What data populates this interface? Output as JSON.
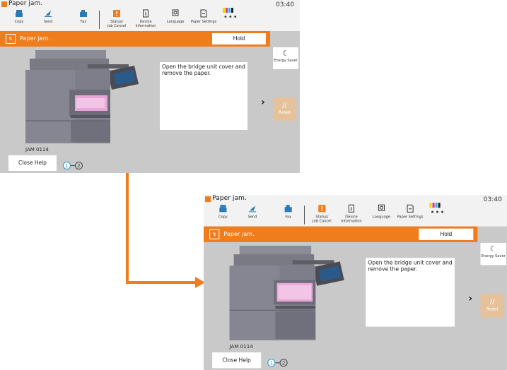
{
  "status_message": "Paper jam.",
  "clock": "03:40",
  "toner_colors": [
    "#f5d400",
    "#e0308f",
    "#33b5e5",
    "#222222"
  ],
  "toolbar": {
    "copy": "Copy",
    "send": "Send",
    "fax": "Fax",
    "status_line1": "Status/",
    "status_line2": "Job Cancel",
    "device_line1": "Device",
    "device_line2": "Information",
    "language": "Language",
    "paper_settings": "Paper Settings",
    "more": "•••"
  },
  "header": {
    "icon": "paper-jam-icon",
    "title": "Paper jam.",
    "hold_label": "Hold"
  },
  "side": {
    "energy_saver": "Energy Saver",
    "reset": "Reset"
  },
  "instruction": "Open the bridge unit cover and remove the paper.",
  "jam_code": "JAM 0114",
  "close_help": "Close Help",
  "steps": [
    "1",
    "2"
  ],
  "current_step": 1,
  "colors": {
    "accent": "#f07d1c",
    "panel_bg": "#c9c9c9",
    "reset_bg": "#e6c29a",
    "step_active": "#2e9ad0"
  }
}
